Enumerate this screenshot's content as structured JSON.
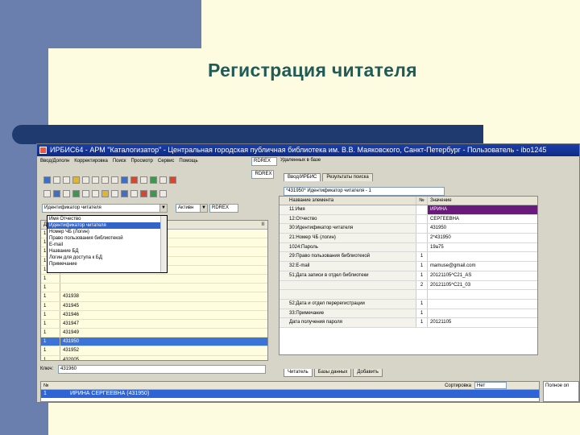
{
  "slide": {
    "title": "Регистрация читателя"
  },
  "window": {
    "title": "ИРБИС64 - АРМ \"Каталогизатор\" - Центральная городская публичная библиотека им. В.В. Маяковского, Санкт-Петербург - Пользователь - ibo1245",
    "menu": [
      "Ввод/Дополн",
      "Корректировка",
      "Поиск",
      "Просмотр",
      "Сервис",
      "Помощь"
    ],
    "db_label": "RDREX",
    "db_status": "Удаленных в базе",
    "db_name": "RDREX",
    "top_tabs": [
      "Ввод/ИРБИС",
      "Результаты поиска"
    ],
    "record_field": "*431950* Идентификатор читателя - 1",
    "left_search_field": "Идентификатор читателя",
    "option_select": "Активн",
    "left_dropdown_items": [
      "Имя Отчество",
      "Идентификатор читателя",
      "Номер ЧБ (Логин)",
      "Право пользования библиотекой",
      "E-mail",
      "Название БД",
      "Логин для доступа к БД",
      "Примечание"
    ],
    "left_list_header": "Де",
    "left_list_col": "II",
    "left_rows": [
      {
        "n": "1",
        "v": ""
      },
      {
        "n": "1",
        "v": ""
      },
      {
        "n": "1",
        "v": ""
      },
      {
        "n": "1",
        "v": ""
      },
      {
        "n": "1",
        "v": ""
      },
      {
        "n": "1",
        "v": ""
      },
      {
        "n": "1",
        "v": ""
      },
      {
        "n": "1",
        "v": "431938"
      },
      {
        "n": "1",
        "v": "431945"
      },
      {
        "n": "1",
        "v": "431946"
      },
      {
        "n": "1",
        "v": "431947"
      },
      {
        "n": "1",
        "v": "431949"
      },
      {
        "n": "1",
        "v": "431950"
      },
      {
        "n": "1",
        "v": "431952"
      },
      {
        "n": "1",
        "v": "432005"
      }
    ],
    "key_label": "Ключ:",
    "key_value": "431960",
    "right_head": {
      "field": "Название элемента",
      "no": "№",
      "value": "Значение"
    },
    "right_rows": [
      {
        "field": "11:Имя",
        "no": "",
        "value": "ИРИНА"
      },
      {
        "field": "12:Отчество",
        "no": "",
        "value": "СЕРГЕЕВНА"
      },
      {
        "field": "30:Идентификатор читателя",
        "no": "",
        "value": "431950"
      },
      {
        "field": "21:Номер ЧБ (логин)",
        "no": "",
        "value": "2*431950"
      },
      {
        "field": "1024:Пароль",
        "no": "",
        "value": "19a75"
      },
      {
        "field": "29:Право пользования библиотекой",
        "no": "1",
        "value": ""
      },
      {
        "field": "32:E-mail",
        "no": "1",
        "value": "mamuse@gmail.com"
      },
      {
        "field": "51:Дата записи в отдел библиотеки",
        "no": "1",
        "value": "20121105^C21_AS"
      },
      {
        "field": "",
        "no": "2",
        "value": "20121105^C21_03"
      },
      {
        "field": "",
        "no": "",
        "value": ""
      },
      {
        "field": "52:Дата и отдел перерегистрации",
        "no": "1",
        "value": ""
      },
      {
        "field": "33:Примечание",
        "no": "1",
        "value": ""
      },
      {
        "field": "Дата получения пароля",
        "no": "1",
        "value": "20121105"
      }
    ],
    "bottom_tabs": [
      "Читатель",
      "Базы данных",
      "Добавить"
    ],
    "bottom_head": {
      "no": "№",
      "sort_label": "Сортировка",
      "sort_value": "Нет"
    },
    "bottom_row": {
      "n": "1",
      "v": "ИРИНА СЕРГЕЕВНА (431950)"
    },
    "side_label": "Полное оп"
  }
}
